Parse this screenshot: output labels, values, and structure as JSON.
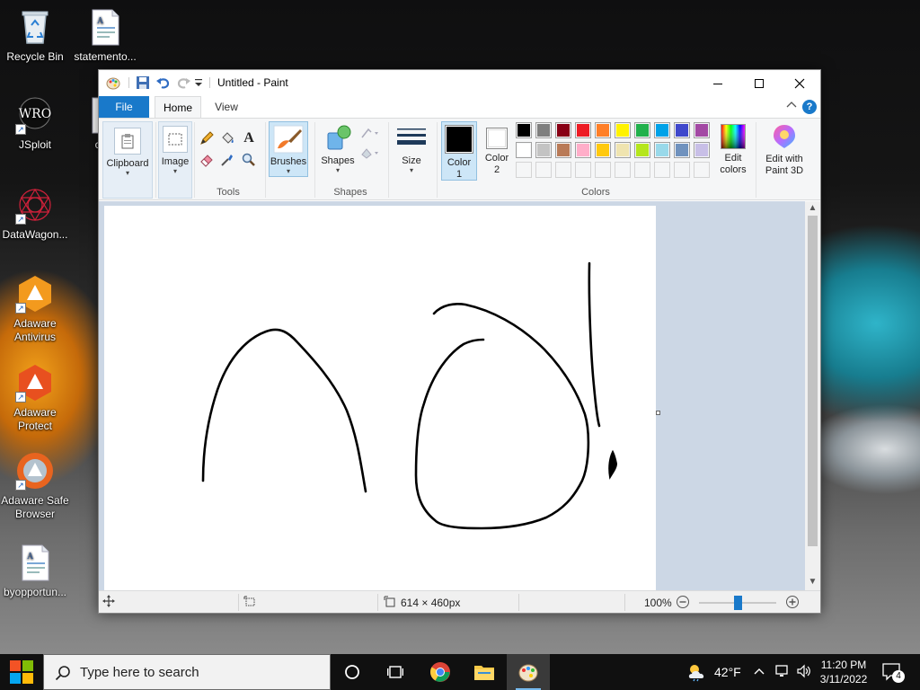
{
  "desktop": {
    "icons": [
      {
        "label": "Recycle Bin",
        "icon": "recycle-bin-icon"
      },
      {
        "label": "statemento...",
        "icon": "document-icon"
      },
      {
        "label": "JSploit",
        "icon": "jsploit-icon"
      },
      {
        "label": "com",
        "icon": "document-icon"
      },
      {
        "label": "DataWagon...",
        "icon": "datawagon-icon"
      },
      {
        "label": "Adaware Antivirus",
        "icon": "adaware-antivirus-icon"
      },
      {
        "label": "Adaware Protect",
        "icon": "adaware-protect-icon"
      },
      {
        "label": "Adaware Safe Browser",
        "icon": "adaware-safe-browser-icon"
      },
      {
        "label": "byopportun...",
        "icon": "document-icon"
      }
    ],
    "jsploit_logo_text": "WRO"
  },
  "paint": {
    "title": "Untitled - Paint",
    "tabs": {
      "file": "File",
      "home": "Home",
      "view": "View"
    },
    "help": "?",
    "ribbon": {
      "clipboard": {
        "label": "Clipboard"
      },
      "image": {
        "label": "Image"
      },
      "tools": {
        "group_label": "Tools",
        "text_tool": "A"
      },
      "brushes": {
        "label": "Brushes"
      },
      "shapes": {
        "label": "Shapes",
        "group_label": "Shapes"
      },
      "size": {
        "label": "Size"
      },
      "color1": {
        "label": "Color",
        "num": "1",
        "value": "#000000"
      },
      "color2": {
        "label": "Color",
        "num": "2",
        "value": "#ffffff"
      },
      "colors_group_label": "Colors",
      "edit_colors": {
        "label1": "Edit",
        "label2": "colors"
      },
      "paint3d": {
        "label1": "Edit with",
        "label2": "Paint 3D"
      },
      "palette_row1": [
        "#000000",
        "#7f7f7f",
        "#880015",
        "#ed1c24",
        "#ff7f27",
        "#fff200",
        "#22b14c",
        "#00a2e8",
        "#3f48cc",
        "#a349a4"
      ],
      "palette_row2": [
        "#ffffff",
        "#c3c3c3",
        "#b97a57",
        "#ffaec9",
        "#ffc90e",
        "#efe4b0",
        "#b5e61d",
        "#99d9ea",
        "#7092be",
        "#c8bfe7"
      ],
      "palette_row3": [
        "#f5f6f7",
        "#f5f6f7",
        "#f5f6f7",
        "#f5f6f7",
        "#f5f6f7",
        "#f5f6f7",
        "#f5f6f7",
        "#f5f6f7",
        "#f5f6f7",
        "#f5f6f7"
      ]
    },
    "status": {
      "canvas_size": "614 × 460px",
      "zoom": "100%",
      "zoom_level": 0.5
    }
  },
  "taskbar": {
    "search_placeholder": "Type here to search",
    "weather": "42°F",
    "time": "11:20 PM",
    "date": "3/11/2022",
    "notifications": "4"
  }
}
